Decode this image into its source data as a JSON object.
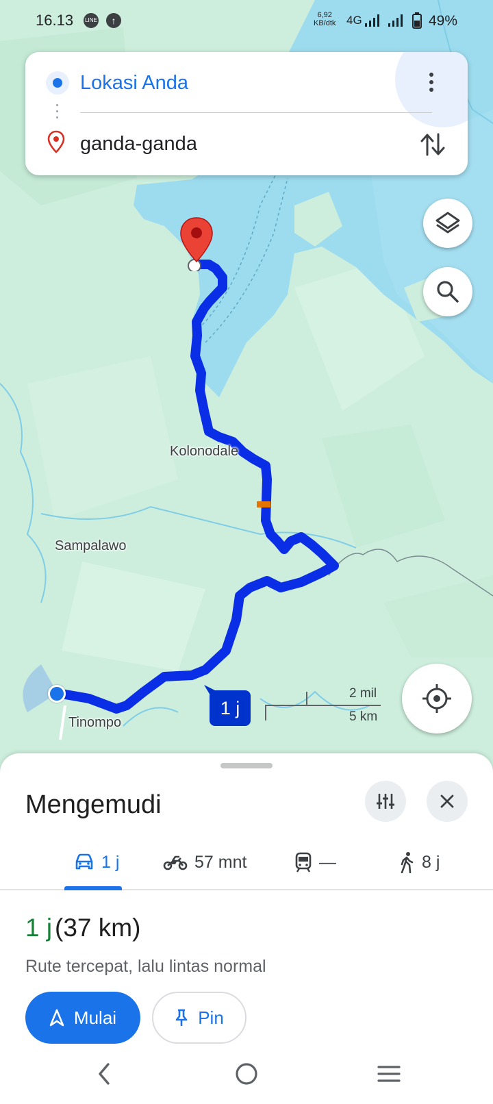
{
  "status_bar": {
    "time": "16.13",
    "speed_value": "6,92",
    "speed_unit": "KB/dtk",
    "network": "4G",
    "battery": "49%",
    "line_badge": "LINE"
  },
  "route_card": {
    "origin": "Lokasi Anda",
    "destination": "ganda-ganda"
  },
  "map": {
    "labels": {
      "kolonodale": "Kolonodale",
      "sampalawo": "Sampalawo",
      "tinompo": "Tinompo"
    },
    "duration_chip": "1 j",
    "scale_mil": "2 mil",
    "scale_km": "5 km",
    "colors": {
      "water": "#9ddcef",
      "land": "#cdeedd",
      "route": "#0a2ee6",
      "traffic": "#e37400"
    }
  },
  "sheet": {
    "title": "Mengemudi",
    "tabs": [
      {
        "mode": "car-icon",
        "label": "1 j"
      },
      {
        "mode": "motorcycle-icon",
        "label": "57 mnt"
      },
      {
        "mode": "transit-icon",
        "label": "—"
      },
      {
        "mode": "walk-icon",
        "label": "8 j"
      }
    ],
    "summary": {
      "time": "1 j",
      "distance": "(37 km)",
      "description": "Rute tercepat, lalu lintas normal"
    },
    "start_label": "Mulai",
    "pin_label": "Pin"
  }
}
